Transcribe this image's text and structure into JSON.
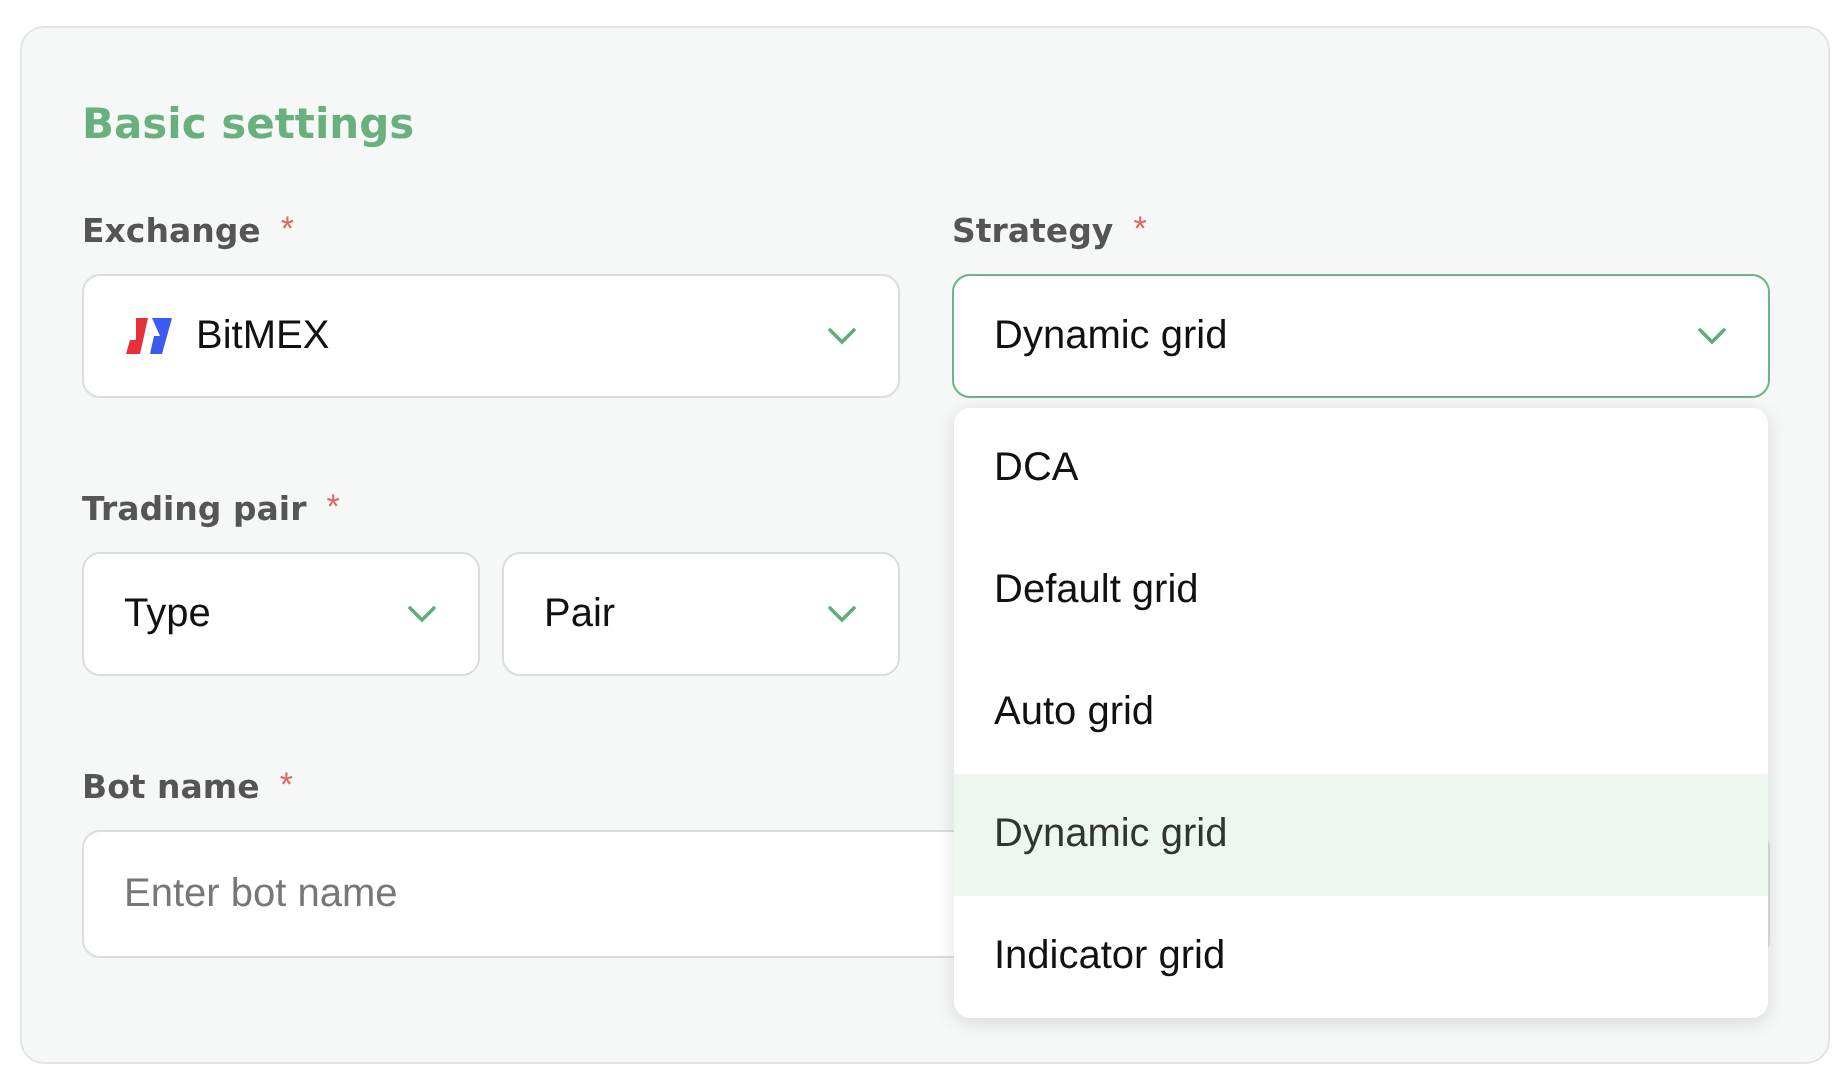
{
  "section": {
    "title": "Basic settings"
  },
  "exchange": {
    "label": "Exchange",
    "required_mark": "*",
    "value": "BitMEX"
  },
  "strategy": {
    "label": "Strategy",
    "required_mark": "*",
    "value": "Dynamic grid",
    "expanded": true,
    "options": [
      {
        "label": "DCA",
        "selected": false
      },
      {
        "label": "Default grid",
        "selected": false
      },
      {
        "label": "Auto grid",
        "selected": false
      },
      {
        "label": "Dynamic grid",
        "selected": true
      },
      {
        "label": "Indicator grid",
        "selected": false
      }
    ]
  },
  "trading_pair": {
    "label": "Trading pair",
    "required_mark": "*",
    "selects": [
      {
        "value": "Type"
      },
      {
        "value": "Pair"
      }
    ]
  },
  "bot_name": {
    "label": "Bot name",
    "required_mark": "*",
    "placeholder": "Enter bot name"
  }
}
